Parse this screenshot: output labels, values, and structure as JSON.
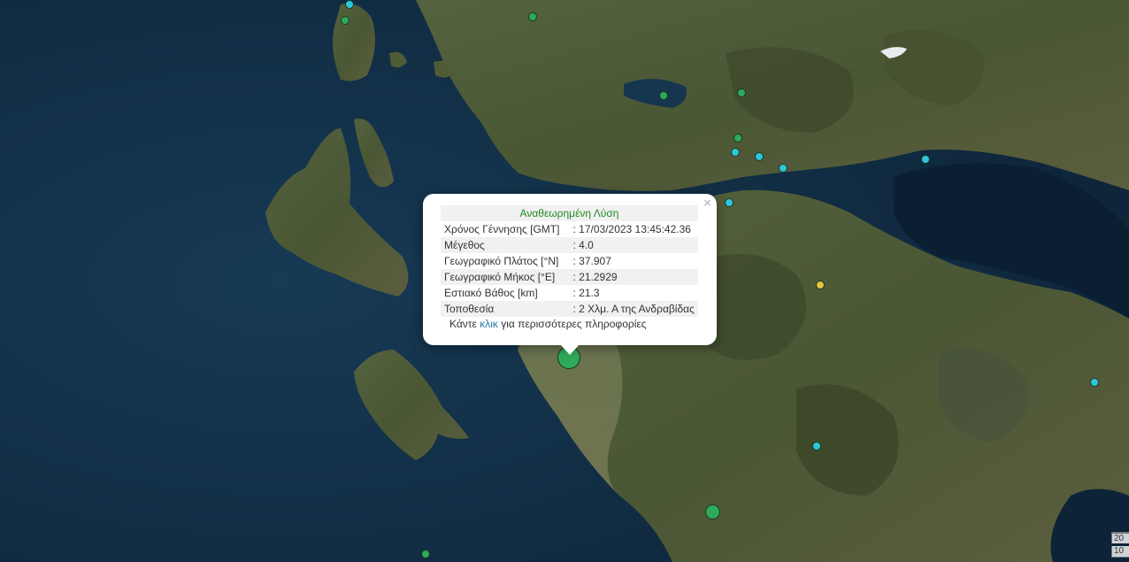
{
  "popup": {
    "title": "Αναθεωρημένη Λύση",
    "close_symbol": "×",
    "rows": [
      {
        "label": "Χρόνος Γέννησης [GMT]",
        "value": ": 17/03/2023 13:45:42.36"
      },
      {
        "label": "Μέγεθος",
        "value": ": 4.0"
      },
      {
        "label": "Γεωγραφικό Πλάτος [°N]",
        "value": ": 37.907"
      },
      {
        "label": "Γεωγραφικό Μήκος [°E]",
        "value": ": 21.2929"
      },
      {
        "label": "Εστιακό Βάθος [km]",
        "value": ": 21.3"
      },
      {
        "label": "Τοποθεσία",
        "value": ": 2 Χλμ. Α της Ανδραβίδας"
      }
    ],
    "more_prefix": "Κάντε ",
    "more_link": "κλικ",
    "more_suffix": " για περισσότερες πληροφορίες"
  },
  "scale": {
    "top_label": "20",
    "bottom_label": "10"
  },
  "colors": {
    "sea": "#0f2a42",
    "land": "#4b5a36",
    "marker_cyan": "#2ec6dc",
    "marker_green": "#2eaa5a",
    "marker_yellow": "#e8c23a",
    "popup_title": "#1f8a1f",
    "link": "#2a7aa8"
  },
  "legend_note": ""
}
